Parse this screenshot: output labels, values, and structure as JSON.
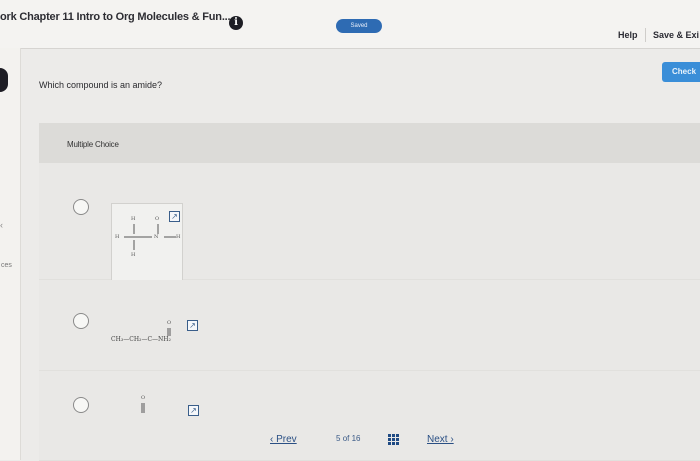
{
  "header": {
    "title": "ork Chapter 11 Intro to Org Molecules & Fun...",
    "info_icon": "info-icon",
    "saved_label": "Saved",
    "help_label": "Help",
    "save_exit_label": "Save & Exi"
  },
  "left_rail": {
    "label_partial": "ces",
    "arrow": "‹"
  },
  "check_label": "Check",
  "question": "Which compound is an amide?",
  "choices": {
    "header": "Multiple Choice",
    "options": [
      {
        "atoms": {
          "o": "O",
          "h_top": "H",
          "h_left": "H",
          "n": "N",
          "h_right": "H",
          "h_bottom": "H"
        },
        "expand_icon": "expand-icon"
      },
      {
        "formula": "CH₃—CH₂—C—NH₂",
        "carbonyl_o": "O",
        "expand_icon": "expand-icon"
      },
      {
        "carbonyl_o": "O",
        "expand_icon": "expand-icon"
      }
    ]
  },
  "pager": {
    "prev_label": "‹ Prev",
    "current": "5",
    "of_label": "of",
    "total": "16",
    "next_label": "Next ›"
  },
  "colors": {
    "accent_blue": "#2e6bb3",
    "check_blue": "#3a8ed8",
    "link_blue": "#2a4f84"
  }
}
